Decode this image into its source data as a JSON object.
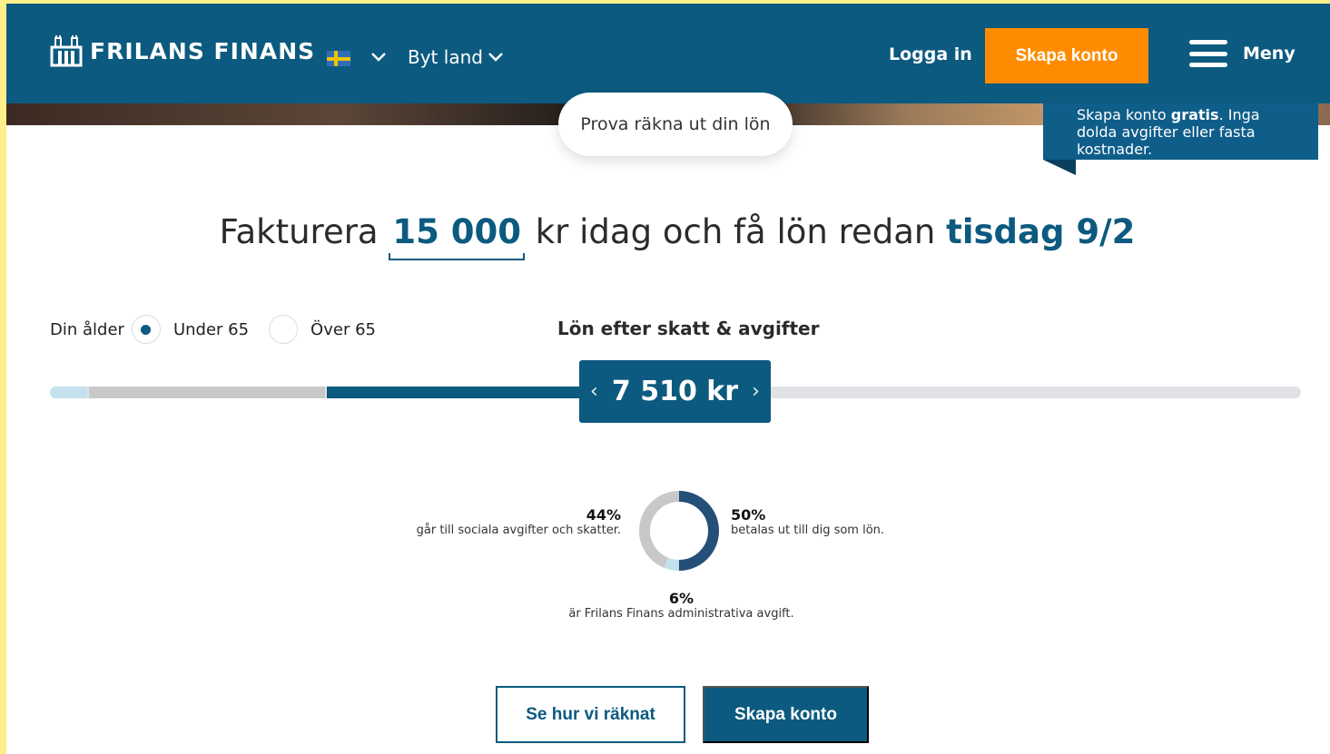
{
  "header": {
    "logo_text": "FRILANS FINANS",
    "country_label": "Byt land",
    "login_label": "Logga in",
    "create_account_label": "Skapa konto",
    "menu_label": "Meny"
  },
  "hero": {
    "calc_pill_label": "Prova räkna ut din lön",
    "promo": {
      "text_before": "Skapa konto ",
      "text_bold": "gratis",
      "text_after": ". Inga dolda avgifter eller fasta kostnader."
    }
  },
  "headline": {
    "prefix": "Fakturera ",
    "amount": "15 000",
    "middle": " kr idag och få lön redan ",
    "pay_date": "tisdag 9/2"
  },
  "age": {
    "label": "Din ålder",
    "options": [
      {
        "label": "Under 65",
        "selected": true
      },
      {
        "label": "Över 65",
        "selected": false
      }
    ]
  },
  "salary": {
    "label": "Lön efter skatt & avgifter",
    "value": "7 510 kr",
    "prev_arrow": "‹",
    "next_arrow": "›",
    "segments": [
      {
        "name": "admin-fee",
        "fraction": 0.03,
        "color": "#c5e1ee"
      },
      {
        "name": "taxes",
        "fraction": 0.19,
        "color": "#c8c8c8"
      },
      {
        "name": "salary",
        "fraction": 0.21,
        "color": "#0c5a7f"
      }
    ]
  },
  "breakdown": {
    "taxes": {
      "pct": "44%",
      "text": "går till sociala avgifter och skatter.",
      "value": 44,
      "color": "#c8c8c8"
    },
    "salary": {
      "pct": "50%",
      "text": "betalas ut till dig som lön.",
      "value": 50,
      "color": "#234f78"
    },
    "fee": {
      "pct": "6%",
      "text": "är Frilans Finans administrativa avgift.",
      "value": 6,
      "color": "#c5e1ee"
    }
  },
  "actions": {
    "how_label": "Se hur vi räknat",
    "create_label": "Skapa konto"
  }
}
